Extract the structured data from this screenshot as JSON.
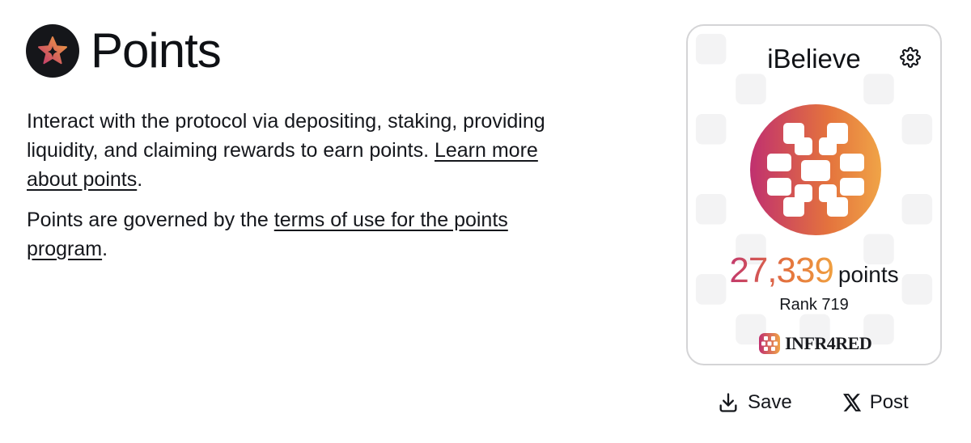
{
  "header": {
    "title": "Points",
    "logo_icon": "star-icon"
  },
  "description": {
    "line1_text": "Interact with the protocol via depositing, staking, providing liquidity, and claiming rewards to earn points. ",
    "line1_link": "Learn more about points",
    "line1_end": ".",
    "line2_text": "Points are governed by the ",
    "line2_link": "terms of use for the points program",
    "line2_end": "."
  },
  "card": {
    "username": "iBelieve",
    "points_value": "27,339",
    "points_unit": "points",
    "rank": "Rank 719",
    "brand": "INFR4RED",
    "gradient_colors": [
      "#c2396d",
      "#e4733d",
      "#f0a040"
    ]
  },
  "actions": {
    "save_label": "Save",
    "post_label": "Post"
  }
}
